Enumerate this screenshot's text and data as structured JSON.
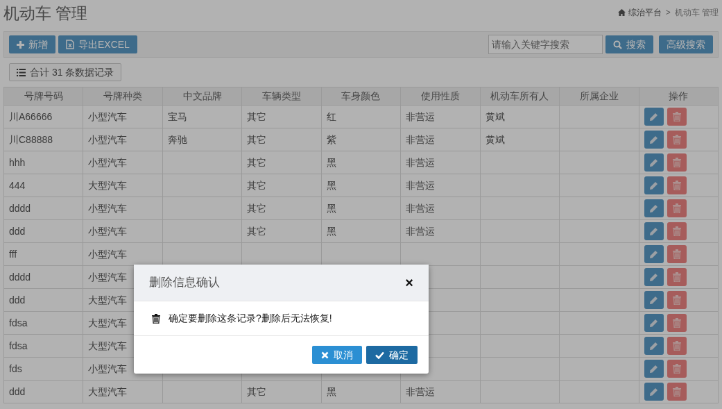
{
  "page_title": "机动车 管理",
  "breadcrumb": [
    {
      "label": "综治平台",
      "kind": "home"
    },
    {
      "label": ">",
      "kind": "separator"
    },
    {
      "label": "机动车 管理",
      "kind": "current"
    }
  ],
  "toolbar": {
    "buttons": [
      {
        "label": "新增",
        "kind": "add"
      },
      {
        "label": "导出EXCEL",
        "kind": "export"
      }
    ],
    "search": {
      "placeholder": "请输入关键字搜索"
    },
    "search_button": "搜索",
    "advanced_button": "高级搜索"
  },
  "record_count": "合计 31 条数据记录",
  "table": {
    "columns": [
      "号牌号码",
      "号牌种类",
      "中文品牌",
      "车辆类型",
      "车身颜色",
      "使用性质",
      "机动车所有人",
      "所属企业",
      "操作"
    ],
    "rows": [
      {
        "cells": [
          "川A66666",
          "小型汽车",
          "宝马",
          "其它",
          "红",
          "非营运",
          "黄斌",
          ""
        ]
      },
      {
        "cells": [
          "川C88888",
          "小型汽车",
          "奔驰",
          "其它",
          "紫",
          "非营运",
          "黄斌",
          ""
        ]
      },
      {
        "cells": [
          "hhh",
          "小型汽车",
          "",
          "其它",
          "黑",
          "非营运",
          "",
          ""
        ]
      },
      {
        "cells": [
          "444",
          "大型汽车",
          "",
          "其它",
          "黑",
          "非营运",
          "",
          ""
        ]
      },
      {
        "cells": [
          "dddd",
          "小型汽车",
          "",
          "其它",
          "黑",
          "非营运",
          "",
          ""
        ]
      },
      {
        "cells": [
          "ddd",
          "小型汽车",
          "",
          "其它",
          "黑",
          "非营运",
          "",
          ""
        ]
      },
      {
        "cells": [
          "fff",
          "小型汽车",
          "",
          "",
          "",
          "",
          "",
          ""
        ]
      },
      {
        "cells": [
          "dddd",
          "小型汽车",
          null,
          null,
          null,
          null,
          "",
          ""
        ]
      },
      {
        "cells": [
          "ddd",
          "大型汽车",
          null,
          null,
          null,
          null,
          "",
          ""
        ]
      },
      {
        "cells": [
          "fdsa",
          "大型汽车",
          null,
          null,
          null,
          null,
          "",
          ""
        ]
      },
      {
        "cells": [
          "fdsa",
          "大型汽车",
          null,
          null,
          null,
          null,
          "",
          ""
        ]
      },
      {
        "cells": [
          "fds",
          "小型汽车",
          null,
          null,
          null,
          null,
          "",
          ""
        ]
      },
      {
        "cells": [
          "ddd",
          "大型汽车",
          "",
          "其它",
          "黑",
          "非营运",
          "",
          ""
        ]
      }
    ]
  },
  "dialog": {
    "title": "删除信息确认",
    "close": "×",
    "message": "确定要删除这条记录?删除后无法恢复!",
    "buttons": [
      {
        "label": "取消",
        "kind": "cancel"
      },
      {
        "label": "确定",
        "kind": "confirm"
      }
    ]
  }
}
